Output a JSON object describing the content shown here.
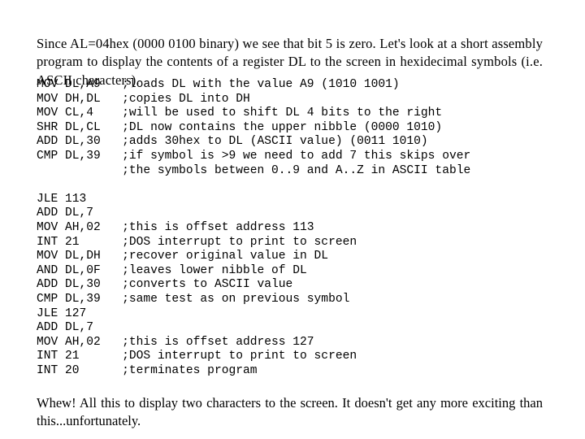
{
  "slide": {
    "background_color": "#ffffff",
    "text_color": "#000000",
    "intro_paragraph": "Since AL=04hex (0000 0100 binary) we see that bit 5 is zero. Let's look at a short assembly program to display the contents of a register DL to the screen in hexidecimal symbols (i.e. ASCII characters).",
    "outro_paragraph": "Whew!  All this to display two characters to the screen. It doesn't get any more exciting than this...unfortunately."
  },
  "code": {
    "comment_column": 12,
    "lines": [
      {
        "instruction": "MOV DL,A9",
        "comment": ";loads DL with the value A9 (1010 1001)",
        "text": "MOV DL,A9   ;loads DL with the value A9 (1010 1001)"
      },
      {
        "instruction": "MOV DH,DL",
        "comment": ";copies DL into DH",
        "text": "MOV DH,DL   ;copies DL into DH"
      },
      {
        "instruction": "MOV CL,4",
        "comment": ";will be used to shift DL 4 bits to the right",
        "text": "MOV CL,4    ;will be used to shift DL 4 bits to the right"
      },
      {
        "instruction": "SHR DL,CL",
        "comment": ";DL now contains the upper nibble (0000 1010)",
        "text": "SHR DL,CL   ;DL now contains the upper nibble (0000 1010)"
      },
      {
        "instruction": "ADD DL,30",
        "comment": ";adds 30hex to DL (ASCII value) (0011 1010)",
        "text": "ADD DL,30   ;adds 30hex to DL (ASCII value) (0011 1010)"
      },
      {
        "instruction": "CMP DL,39",
        "comment": ";if symbol is >9 we need to add 7 this skips over",
        "text": "CMP DL,39   ;if symbol is >9 we need to add 7 this skips over"
      },
      {
        "instruction": "",
        "comment": ";the symbols between 0..9 and A..Z in ASCII table",
        "text": "            ;the symbols between 0..9 and A..Z in ASCII table"
      },
      {
        "instruction": "",
        "comment": "",
        "text": ""
      },
      {
        "instruction": "JLE 113",
        "comment": "",
        "text": "JLE 113"
      },
      {
        "instruction": "ADD DL,7",
        "comment": "",
        "text": "ADD DL,7"
      },
      {
        "instruction": "MOV AH,02",
        "comment": ";this is offset address 113",
        "text": "MOV AH,02   ;this is offset address 113"
      },
      {
        "instruction": "INT 21",
        "comment": ";DOS interrupt to print to screen",
        "text": "INT 21      ;DOS interrupt to print to screen"
      },
      {
        "instruction": "MOV DL,DH",
        "comment": ";recover original value in DL",
        "text": "MOV DL,DH   ;recover original value in DL"
      },
      {
        "instruction": "AND DL,0F",
        "comment": ";leaves lower nibble of DL",
        "text": "AND DL,0F   ;leaves lower nibble of DL"
      },
      {
        "instruction": "ADD DL,30",
        "comment": ";converts to ASCII value",
        "text": "ADD DL,30   ;converts to ASCII value"
      },
      {
        "instruction": "CMP DL,39",
        "comment": ";same test as on previous symbol",
        "text": "CMP DL,39   ;same test as on previous symbol"
      },
      {
        "instruction": "JLE 127",
        "comment": "",
        "text": "JLE 127"
      },
      {
        "instruction": "ADD DL,7",
        "comment": "",
        "text": "ADD DL,7"
      },
      {
        "instruction": "MOV AH,02",
        "comment": ";this is offset address 127",
        "text": "MOV AH,02   ;this is offset address 127"
      },
      {
        "instruction": "INT 21",
        "comment": ";DOS interrupt to print to screen",
        "text": "INT 21      ;DOS interrupt to print to screen"
      },
      {
        "instruction": "INT 20",
        "comment": ";terminates program",
        "text": "INT 20      ;terminates program"
      }
    ]
  }
}
